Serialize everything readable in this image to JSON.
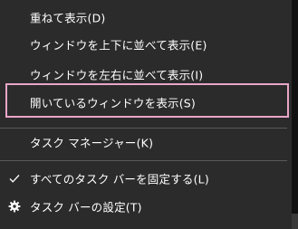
{
  "context_menu": {
    "items": [
      {
        "label": "重ねて表示(D)"
      },
      {
        "label": "ウィンドウを上下に並べて表示(E)"
      },
      {
        "label": "ウィンドウを左右に並べて表示(I)"
      },
      {
        "label": "開いているウィンドウを表示(S)"
      },
      {
        "label": "タスク マネージャー(K)"
      },
      {
        "label": "すべてのタスク バーを固定する(L)",
        "icon": "checkmark-icon"
      },
      {
        "label": "タスク バーの設定(T)",
        "icon": "gear-icon"
      }
    ]
  }
}
